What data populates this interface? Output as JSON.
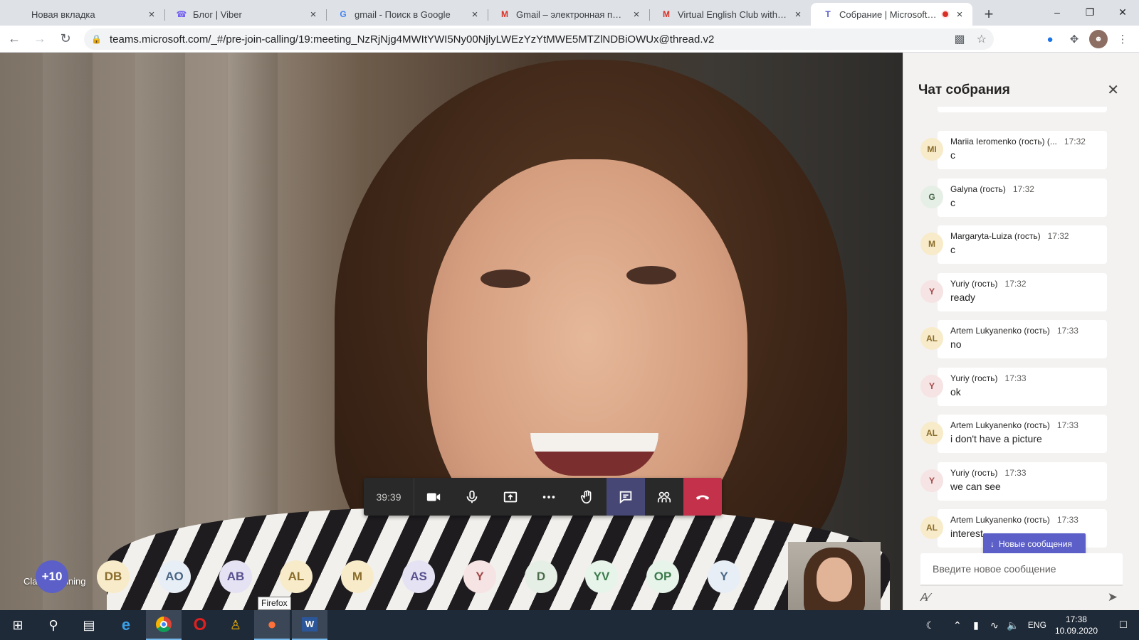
{
  "browser": {
    "tabs": [
      {
        "title": "Новая вкладка",
        "icon": "new-tab-icon",
        "active": false
      },
      {
        "title": "Блог | Viber",
        "icon": "viber-icon",
        "active": false
      },
      {
        "title": "gmail - Поиск в Google",
        "icon": "google-icon",
        "active": false
      },
      {
        "title": "Gmail – электронная почта и",
        "icon": "gmail-icon",
        "active": false
      },
      {
        "title": "Virtual English Club with Clai",
        "icon": "gmail-icon",
        "active": false
      },
      {
        "title": "Собрание | Microsoft Te",
        "icon": "teams-icon",
        "active": true
      }
    ],
    "url": "teams.microsoft.com/_#/pre-join-calling/19:meeting_NzRjNjg4MWItYWI5Ny00NjlyLWEzYzYtMWE5MTZlNDBiOWUx@thread.v2"
  },
  "call": {
    "speaker_name": "Claire Manning",
    "timer": "39:39",
    "participants": [
      {
        "initials": "+10",
        "bg": "#5b5fc7",
        "fg": "#ffffff"
      },
      {
        "initials": "DB",
        "bg": "#f8ebc9",
        "fg": "#8a6d2c"
      },
      {
        "initials": "AO",
        "bg": "#e8eef6",
        "fg": "#4a6785"
      },
      {
        "initials": "AB",
        "bg": "#e5e2f3",
        "fg": "#58518f"
      },
      {
        "initials": "AL",
        "bg": "#f8ebc9",
        "fg": "#8a6d2c"
      },
      {
        "initials": "M",
        "bg": "#f8ebc9",
        "fg": "#8a6d2c"
      },
      {
        "initials": "AS",
        "bg": "#e5e2f3",
        "fg": "#58518f"
      },
      {
        "initials": "Y",
        "bg": "#f6e3e3",
        "fg": "#a14848"
      },
      {
        "initials": "D",
        "bg": "#e6efe6",
        "fg": "#4c6b4c"
      },
      {
        "initials": "YV",
        "bg": "#e6f4ea",
        "fg": "#3c7a4c"
      },
      {
        "initials": "OP",
        "bg": "#e6f4ea",
        "fg": "#3c7a4c"
      },
      {
        "initials": "Y",
        "bg": "#e8eef6",
        "fg": "#4a6785"
      }
    ],
    "tooltip": "Firefox"
  },
  "chat": {
    "title": "Чат собрания",
    "messages": [
      {
        "initials": "MI",
        "author": "Mariia Ieromenko (гость) (...",
        "time": "17:32",
        "text": "c",
        "avatar_bg": "#f8ebc9",
        "avatar_fg": "#8a6d2c"
      },
      {
        "initials": "G",
        "author": "Galyna (гость)",
        "time": "17:32",
        "text": "c",
        "avatar_bg": "#e6efe6",
        "avatar_fg": "#4c6b4c"
      },
      {
        "initials": "M",
        "author": "Margaryta-Luiza (гость)",
        "time": "17:32",
        "text": "c",
        "avatar_bg": "#f8ebc9",
        "avatar_fg": "#8a6d2c"
      },
      {
        "initials": "Y",
        "author": "Yuriy (гость)",
        "time": "17:32",
        "text": "ready",
        "avatar_bg": "#f6e3e3",
        "avatar_fg": "#a14848"
      },
      {
        "initials": "AL",
        "author": "Artem Lukyanenko (гость)",
        "time": "17:33",
        "text": "no",
        "avatar_bg": "#f8ebc9",
        "avatar_fg": "#8a6d2c"
      },
      {
        "initials": "Y",
        "author": "Yuriy (гость)",
        "time": "17:33",
        "text": "ok",
        "avatar_bg": "#f6e3e3",
        "avatar_fg": "#a14848"
      },
      {
        "initials": "AL",
        "author": "Artem Lukyanenko (гость)",
        "time": "17:33",
        "text": "i don't have a picture",
        "avatar_bg": "#f8ebc9",
        "avatar_fg": "#8a6d2c"
      },
      {
        "initials": "Y",
        "author": "Yuriy (гость)",
        "time": "17:33",
        "text": "we can see",
        "avatar_bg": "#f6e3e3",
        "avatar_fg": "#a14848"
      },
      {
        "initials": "AL",
        "author": "Artem Lukyanenko (гость)",
        "time": "17:33",
        "text": "interest",
        "avatar_bg": "#f8ebc9",
        "avatar_fg": "#8a6d2c"
      }
    ],
    "new_messages_label": "Новые сообщения",
    "compose_placeholder": "Введите новое сообщение"
  },
  "taskbar": {
    "lang": "ENG",
    "time": "17:38",
    "date": "10.09.2020"
  }
}
